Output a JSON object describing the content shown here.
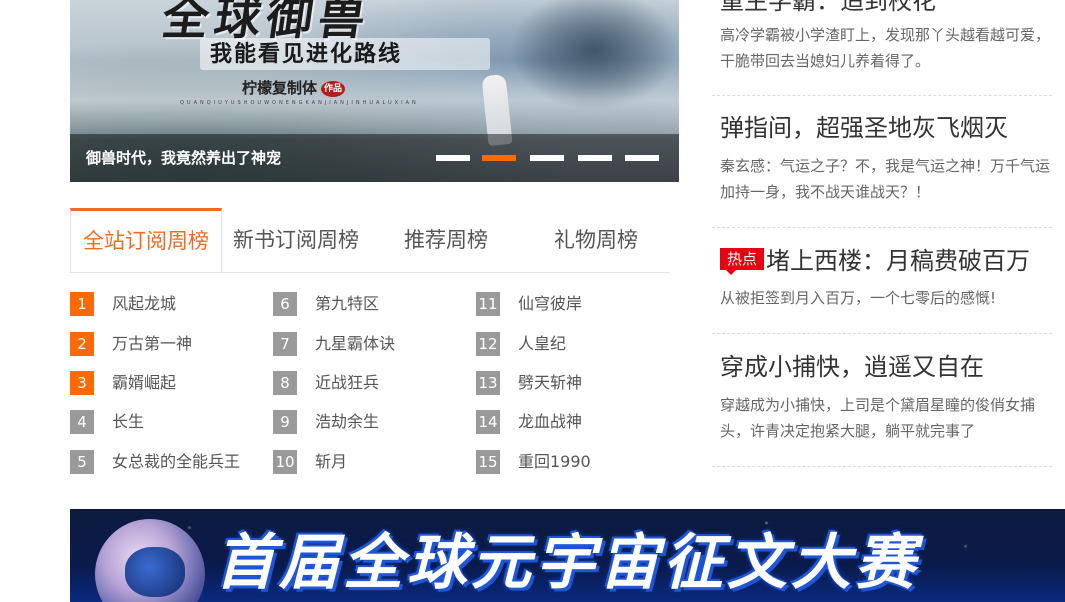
{
  "hero": {
    "art_title": "全球御兽",
    "art_subtitle": "我能看见进化路线",
    "art_author": "柠檬复制体",
    "art_seal": "作品",
    "art_pinyin": "QUANQIUYUSHOUWONENGKANJIANJINHUALUXIAN",
    "caption": "御兽时代，我竟然养出了神宠",
    "slides": 5,
    "active_slide": 2
  },
  "ranking": {
    "tabs": [
      "全站订阅周榜",
      "新书订阅周榜",
      "推荐周榜",
      "礼物周榜"
    ],
    "active_tab": 0,
    "items": [
      {
        "rank": "1",
        "title": "风起龙城"
      },
      {
        "rank": "2",
        "title": "万古第一神"
      },
      {
        "rank": "3",
        "title": "霸婿崛起"
      },
      {
        "rank": "4",
        "title": "长生"
      },
      {
        "rank": "5",
        "title": "女总裁的全能兵王"
      },
      {
        "rank": "6",
        "title": "第九特区"
      },
      {
        "rank": "7",
        "title": "九星霸体诀"
      },
      {
        "rank": "8",
        "title": "近战狂兵"
      },
      {
        "rank": "9",
        "title": "浩劫余生"
      },
      {
        "rank": "10",
        "title": "斩月"
      },
      {
        "rank": "11",
        "title": "仙穹彼岸"
      },
      {
        "rank": "12",
        "title": "人皇纪"
      },
      {
        "rank": "13",
        "title": "劈天斩神"
      },
      {
        "rank": "14",
        "title": "龙血战神"
      },
      {
        "rank": "15",
        "title": "重回1990"
      }
    ]
  },
  "news": [
    {
      "title": "重生学霸：追到校花",
      "desc": "高冷学霸被小学渣盯上，发现那丫头越看越可爱，干脆带回去当媳妇儿养着得了。",
      "hot": false
    },
    {
      "title": "弹指间，超强圣地灰飞烟灭",
      "desc": "秦玄感：气运之子？不，我是气运之神！万千气运加持一身，我不战天谁战天？！",
      "hot": false
    },
    {
      "title": "堵上西楼：月稿费破百万",
      "desc": "从被拒签到月入百万，一个七零后的感慨!",
      "hot": true,
      "hot_label": "热点"
    },
    {
      "title": "穿成小捕快，逍遥又自在",
      "desc": "穿越成为小捕快，上司是个黛眉星瞳的俊俏女捕头，许青决定抱紧大腿，躺平就完事了",
      "hot": false
    }
  ],
  "promo": {
    "text": "首届全球元宇宙征文大赛"
  },
  "colors": {
    "accent": "#ff6a00",
    "tab_active": "#f26a21",
    "hot": "#e60012",
    "rank_gray": "#9a9a9a"
  }
}
